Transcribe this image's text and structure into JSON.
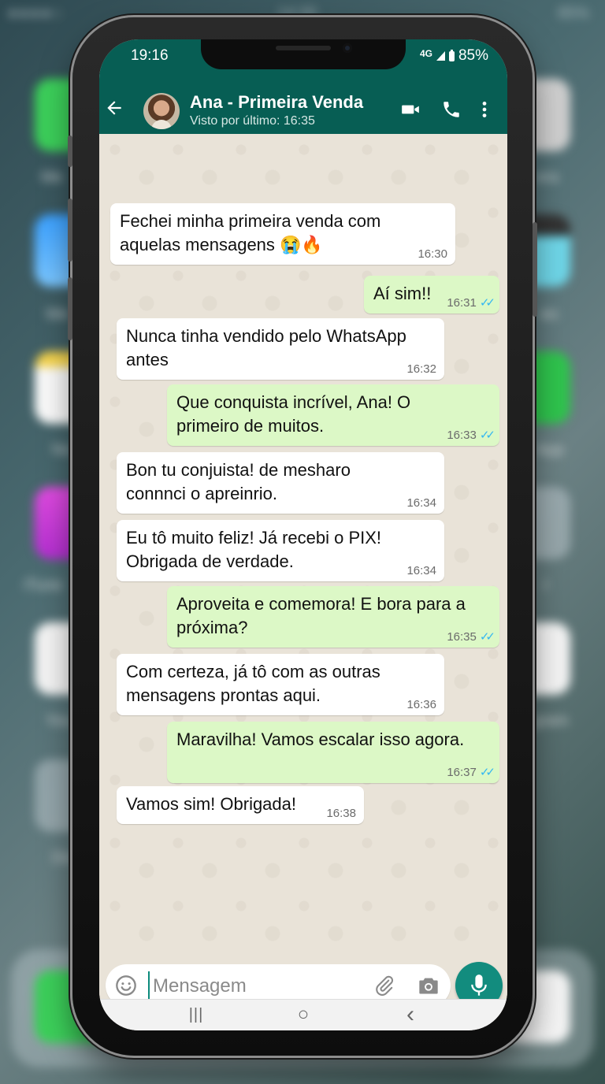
{
  "home_background": {
    "status_time": "14:30",
    "status_battery": "85%",
    "labels": [
      "Me",
      "We",
      "No",
      "iTune",
      "You",
      "Dic",
      "era",
      "eo",
      "App",
      "r",
      "gram"
    ]
  },
  "status_bar": {
    "time": "19:16",
    "network": "4G",
    "battery": "85%"
  },
  "header": {
    "contact_name": "Ana - Primeira Venda",
    "last_seen": "Visto por último: 16:35",
    "icons": [
      "back-arrow-icon",
      "video-call-icon",
      "phone-call-icon",
      "more-options-icon"
    ]
  },
  "messages": [
    {
      "direction": "in",
      "text": "Fechei minha primeira venda com\naquelas mensagens 😭🔥",
      "time": "16:30",
      "ticks": ""
    },
    {
      "direction": "out",
      "text": "Aí sim!!",
      "time": "16:31",
      "ticks": "✓✓"
    },
    {
      "direction": "in",
      "text": "Nunca tinha vendido pelo WhatsApp\nantes",
      "time": "16:32",
      "ticks": ""
    },
    {
      "direction": "out",
      "text": "Que conquista incrível, Ana! O\nprimeiro de muitos.",
      "time": "16:33",
      "ticks": "✓✓"
    },
    {
      "direction": "in",
      "text": "Bon tu conjuista! de mesharo\nconnnci o apreinrio.",
      "time": "16:34",
      "ticks": ""
    },
    {
      "direction": "in",
      "text": "Eu tô muito feliz! Já recebi o PIX!\nObrigada de verdade.",
      "time": "16:34",
      "ticks": ""
    },
    {
      "direction": "out",
      "text": "Aproveita e comemora! E bora para a\npróxima?",
      "time": "16:35",
      "ticks": "✓✓"
    },
    {
      "direction": "in",
      "text": "Com certeza, já tô com as outras\nmensagens prontas aqui.",
      "time": "16:36",
      "ticks": ""
    },
    {
      "direction": "out",
      "text": "Maravilha! Vamos escalar isso agora.",
      "time": "16:37",
      "ticks": "✓✓"
    },
    {
      "direction": "in",
      "text": "Vamos sim! Obrigada!",
      "time": "16:38",
      "ticks": ""
    }
  ],
  "composer": {
    "placeholder": "Mensagem",
    "value": ""
  },
  "nav_bar": {
    "recents": "|||",
    "home": "○",
    "back": "‹"
  },
  "colors": {
    "header": "#075e54",
    "outgoing_bubble": "#dcf8c6",
    "incoming_bubble": "#ffffff",
    "mic_button": "#128c7e",
    "read_ticks": "#34b7f1"
  }
}
